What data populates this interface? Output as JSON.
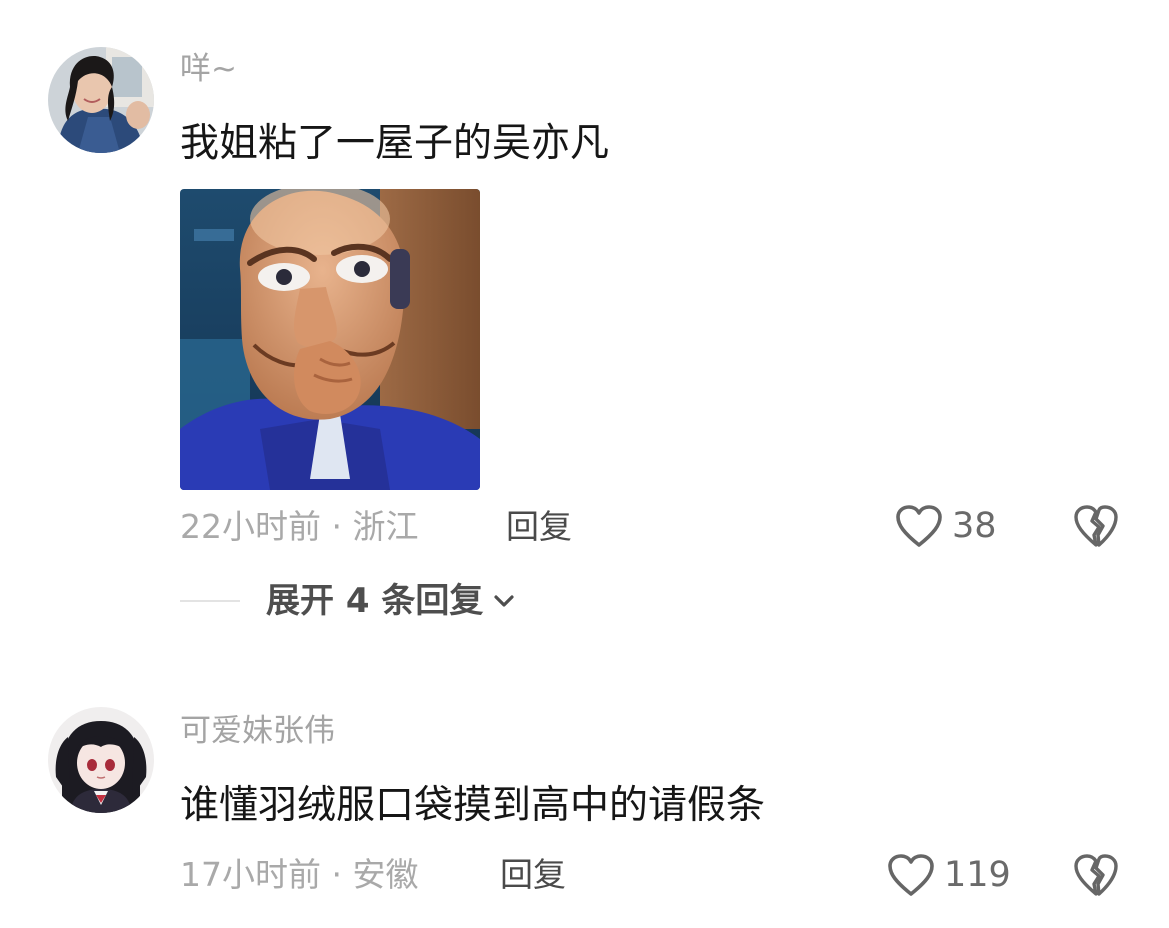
{
  "comments": [
    {
      "username": "咩~",
      "text": "我姐粘了一屋子的吴亦凡",
      "timestamp": "22小时前 · 浙江",
      "reply_label": "回复",
      "like_count": "38",
      "has_image": true,
      "expand_replies_label": "展开 4 条回复"
    },
    {
      "username": "可爱妹张伟",
      "text": "谁懂羽绒服口袋摸到高中的请假条",
      "timestamp": "17小时前 · 安徽",
      "reply_label": "回复",
      "like_count": "119"
    }
  ],
  "icons": {
    "like": "heart-outline-icon",
    "dislike": "broken-heart-icon",
    "expand": "chevron-down-icon"
  },
  "colors": {
    "username": "#a4a4a4",
    "comment_text": "#161616",
    "meta": "#a9a9a9",
    "reply": "#4a4a4a",
    "icon": "#666666"
  }
}
